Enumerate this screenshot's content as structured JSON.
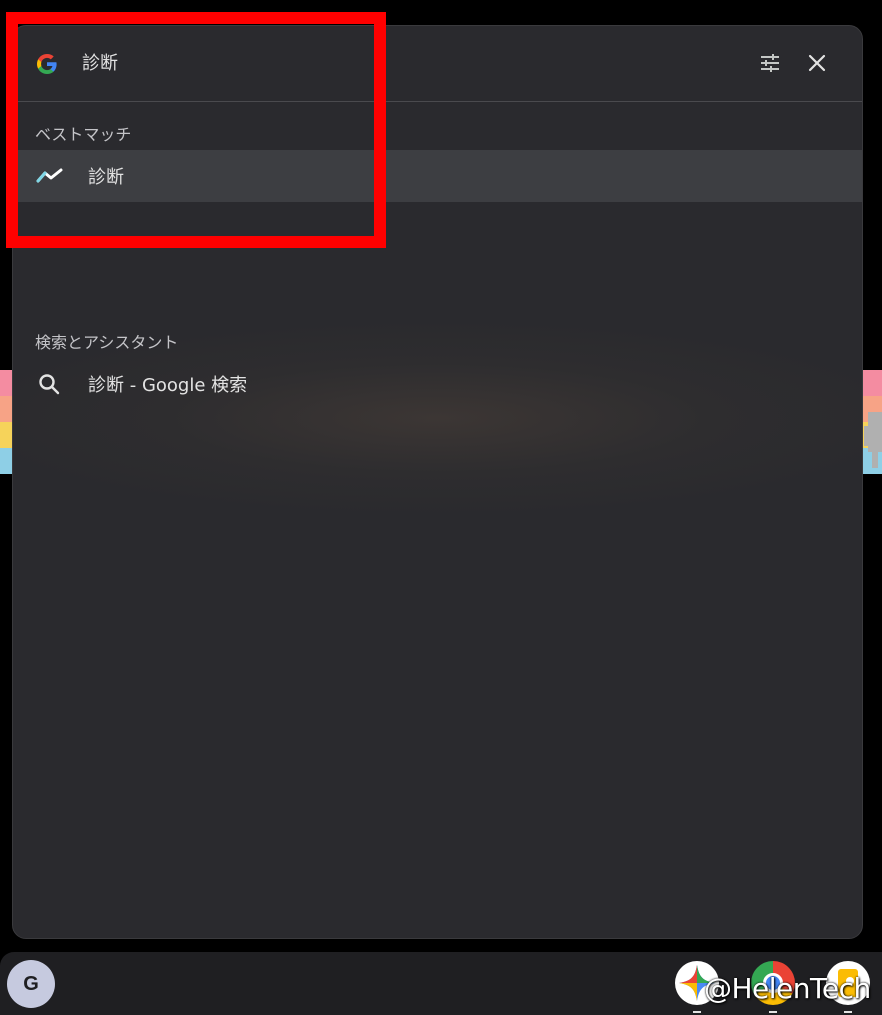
{
  "search": {
    "query": "診断",
    "provider_icon": "google-g-icon",
    "settings_icon": "tune-settings-icon",
    "close_icon": "close-icon"
  },
  "best_match": {
    "section_title": "ベストマッチ",
    "item_label": "診断",
    "item_icon": "trending-line-icon"
  },
  "assistant": {
    "section_title": "検索とアシスタント",
    "item_label": "診断 - Google 検索",
    "item_icon": "search-icon"
  },
  "shelf": {
    "launcher_letter": "G",
    "apps": [
      "gemini-icon",
      "chrome-icon",
      "files-icon"
    ]
  },
  "watermark": "@HelenTech",
  "colors": {
    "highlight": "#ff0000",
    "panel": "#2a2a2e",
    "selected_row": "#3d3e42",
    "accent_trend": "#7fd7e6"
  }
}
